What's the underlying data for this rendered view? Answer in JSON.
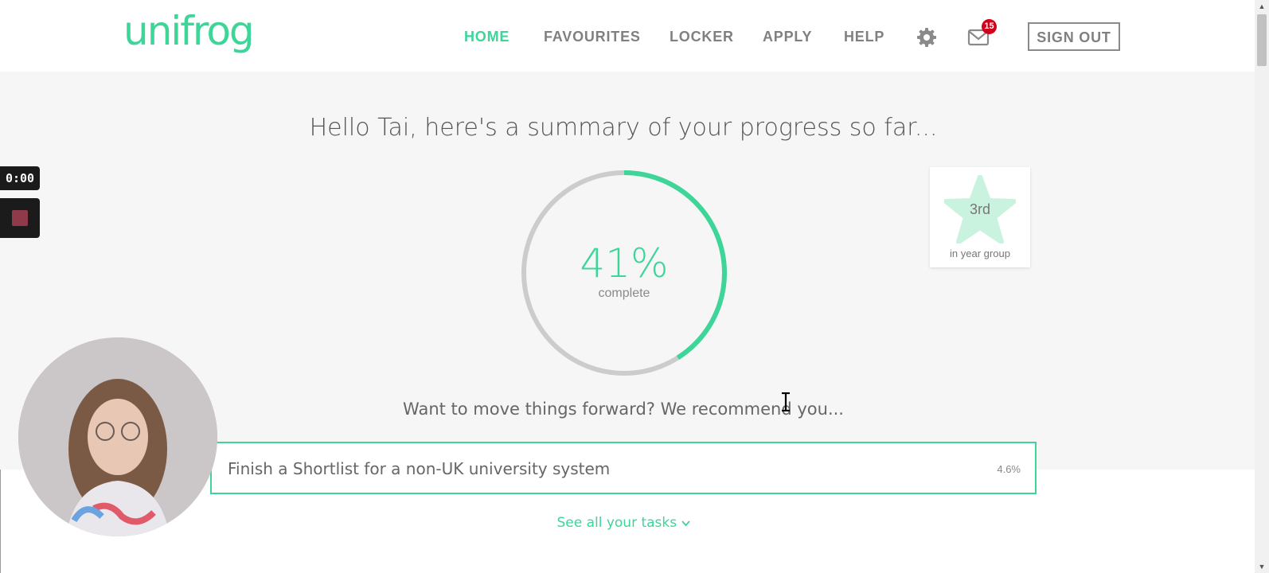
{
  "header": {
    "logo": "unifrog",
    "nav": [
      {
        "label": "HOME",
        "active": true
      },
      {
        "label": "FAVOURITES",
        "active": false
      },
      {
        "label": "LOCKER",
        "active": false
      },
      {
        "label": "APPLY",
        "active": false
      },
      {
        "label": "HELP",
        "active": false
      }
    ],
    "settings_icon": "gear-icon",
    "mail_icon": "envelope-icon",
    "mail_badge": "15",
    "sign_out": "SIGN OUT"
  },
  "summary": {
    "greeting": "Hello Tai, here's a summary of your progress so far...",
    "progress_percent": "41%",
    "progress_value": 0.41,
    "progress_label": "complete",
    "rank": "3rd",
    "rank_label": "in year group"
  },
  "recommendation": {
    "heading": "Want to move things forward? We recommend you...",
    "task": "Finish a Shortlist for a non-UK university system",
    "task_percent": "4.6%",
    "see_all": "See all your tasks"
  },
  "recorder": {
    "time": "0:00"
  },
  "colors": {
    "brand": "#3dd598",
    "ring_track": "#cccccc",
    "badge": "#d0021b"
  }
}
